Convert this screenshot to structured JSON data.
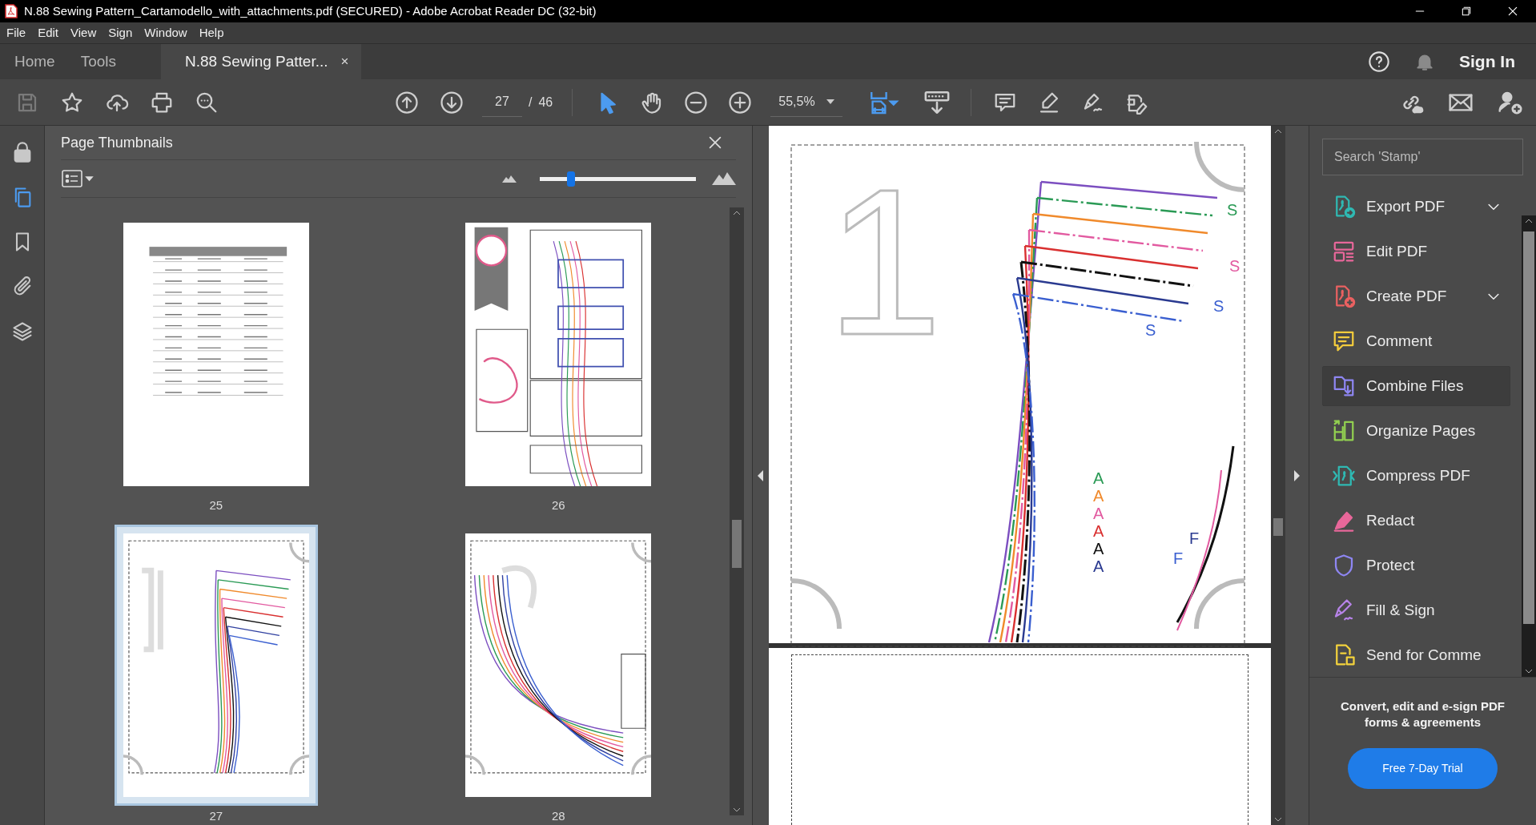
{
  "title_bar": {
    "title": "N.88 Sewing Pattern_Cartamodello_with_attachments.pdf (SECURED) - Adobe Acrobat Reader DC (32-bit)"
  },
  "menu_bar": [
    "File",
    "Edit",
    "View",
    "Sign",
    "Window",
    "Help"
  ],
  "tabs": [
    {
      "label": "Home",
      "selected": false
    },
    {
      "label": "Tools",
      "selected": false
    },
    {
      "label": "N.88 Sewing Patter...",
      "selected": true,
      "close": "×"
    }
  ],
  "sign_in": "Sign In",
  "toolbar": {
    "page_current": "27",
    "page_separator": "/",
    "page_total": "46",
    "zoom": "55,5%",
    "tools": [
      {
        "kind": "select",
        "selected": true
      },
      {
        "kind": "hand",
        "selected": false
      }
    ]
  },
  "left_rail": [
    {
      "kind": "lock",
      "selected": false
    },
    {
      "kind": "pages",
      "selected": true
    },
    {
      "kind": "bookmark",
      "selected": false
    },
    {
      "kind": "attachment",
      "selected": false
    },
    {
      "kind": "layers",
      "selected": false
    }
  ],
  "thumbnails_panel": {
    "title": "Page Thumbnails",
    "size_slider": {
      "level": 0.2
    },
    "pages": [
      {
        "label": "25",
        "kind": "table",
        "selected": false
      },
      {
        "label": "26",
        "kind": "map",
        "selected": false
      },
      {
        "label": "27",
        "kind": "piece_one",
        "selected": true
      },
      {
        "label": "28",
        "kind": "piece_two",
        "selected": false
      }
    ]
  },
  "document": {
    "page_mark": "1",
    "pattern_letters": [
      "S",
      "S",
      "S",
      "S",
      "A",
      "A",
      "A",
      "A",
      "A",
      "A",
      "F",
      "F"
    ]
  },
  "tools_panel": {
    "search": {
      "placeholder": "Search 'Stamp'"
    },
    "items": [
      {
        "label": "Export PDF",
        "kind": "export",
        "color": "#2fb9b3",
        "expandable": true,
        "selected": false
      },
      {
        "label": "Edit PDF",
        "kind": "edit",
        "color": "#e8679a",
        "expandable": false,
        "selected": false
      },
      {
        "label": "Create PDF",
        "kind": "create",
        "color": "#ea6161",
        "expandable": true,
        "selected": false
      },
      {
        "label": "Comment",
        "kind": "comment",
        "color": "#f4cc3c",
        "expandable": false,
        "selected": false
      },
      {
        "label": "Combine Files",
        "kind": "combine",
        "color": "#8e86f2",
        "expandable": false,
        "selected": true
      },
      {
        "label": "Organize Pages",
        "kind": "organize",
        "color": "#92d050",
        "expandable": false,
        "selected": false
      },
      {
        "label": "Compress PDF",
        "kind": "compress",
        "color": "#2fb9b3",
        "expandable": false,
        "selected": false
      },
      {
        "label": "Redact",
        "kind": "redact",
        "color": "#e8679a",
        "expandable": false,
        "selected": false
      },
      {
        "label": "Protect",
        "kind": "protect",
        "color": "#8e86f2",
        "expandable": false,
        "selected": false
      },
      {
        "label": "Fill & Sign",
        "kind": "fill_sign",
        "color": "#b783e8",
        "expandable": false,
        "selected": false
      },
      {
        "label": "Send for Comme",
        "kind": "send",
        "color": "#f4d33c",
        "expandable": false,
        "selected": false
      }
    ],
    "promo": {
      "text": "Convert, edit and e-sign PDF forms & agreements",
      "button": "Free 7-Day Trial"
    }
  }
}
